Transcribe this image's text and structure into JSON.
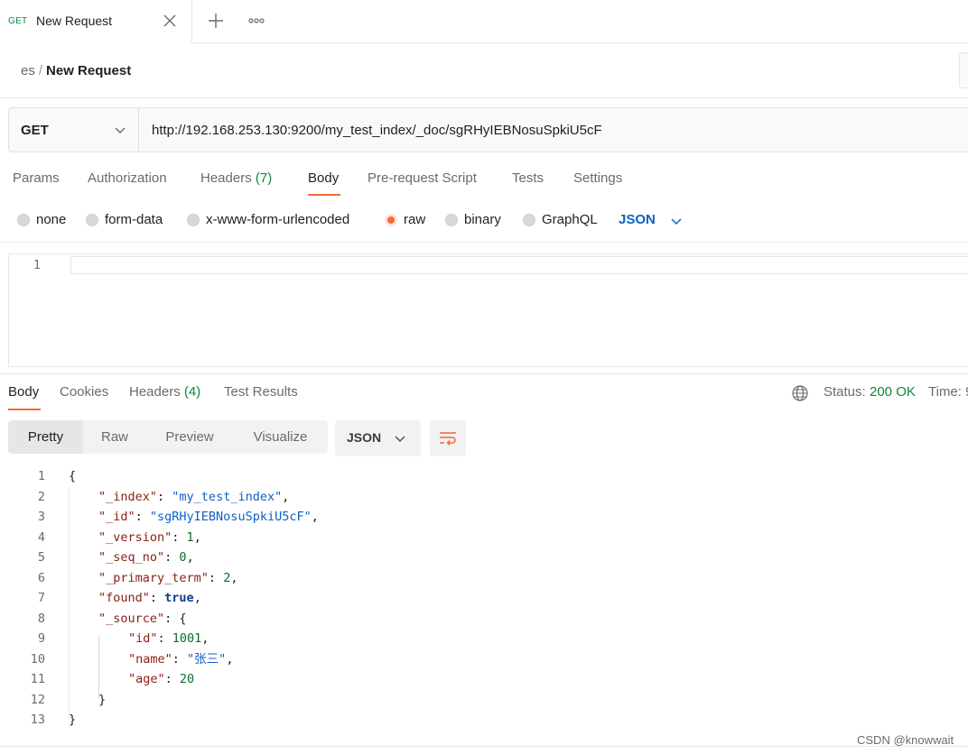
{
  "tab": {
    "method": "GET",
    "title": "New Request"
  },
  "breadcrumb": {
    "parent": "es",
    "separator": "/",
    "current": "New Request"
  },
  "request": {
    "method": "GET",
    "url": "http://192.168.253.130:9200/my_test_index/_doc/sgRHyIEBNosuSpkiU5cF"
  },
  "request_tabs": {
    "params": "Params",
    "authorization": "Authorization",
    "headers": "Headers",
    "headers_count": "(7)",
    "body": "Body",
    "pre_request": "Pre-request Script",
    "tests": "Tests",
    "settings": "Settings"
  },
  "body_types": {
    "none": "none",
    "form_data": "form-data",
    "urlencoded": "x-www-form-urlencoded",
    "raw": "raw",
    "binary": "binary",
    "graphql": "GraphQL",
    "format": "JSON",
    "selected": "raw"
  },
  "request_editor": {
    "line_number": "1"
  },
  "response_tabs": {
    "body": "Body",
    "cookies": "Cookies",
    "headers": "Headers",
    "headers_count": "(4)",
    "test_results": "Test Results"
  },
  "status": {
    "label": "Status:",
    "value": "200 OK",
    "time_label": "Time: 9"
  },
  "view_modes": {
    "pretty": "Pretty",
    "raw": "Raw",
    "preview": "Preview",
    "visualize": "Visualize",
    "format": "JSON"
  },
  "response_lines": [
    {
      "n": "1",
      "indent": 0,
      "parts": [
        [
          "p",
          "{"
        ]
      ]
    },
    {
      "n": "2",
      "indent": 1,
      "parts": [
        [
          "k",
          "\"_index\""
        ],
        [
          "p",
          ": "
        ],
        [
          "sv",
          "\"my_test_index\""
        ],
        [
          "p",
          ","
        ]
      ]
    },
    {
      "n": "3",
      "indent": 1,
      "parts": [
        [
          "k",
          "\"_id\""
        ],
        [
          "p",
          ": "
        ],
        [
          "sv",
          "\"sgRHyIEBNosuSpkiU5cF\""
        ],
        [
          "p",
          ","
        ]
      ]
    },
    {
      "n": "4",
      "indent": 1,
      "parts": [
        [
          "k",
          "\"_version\""
        ],
        [
          "p",
          ": "
        ],
        [
          "nv",
          "1"
        ],
        [
          "p",
          ","
        ]
      ]
    },
    {
      "n": "5",
      "indent": 1,
      "parts": [
        [
          "k",
          "\"_seq_no\""
        ],
        [
          "p",
          ": "
        ],
        [
          "nv",
          "0"
        ],
        [
          "p",
          ","
        ]
      ]
    },
    {
      "n": "6",
      "indent": 1,
      "parts": [
        [
          "k",
          "\"_primary_term\""
        ],
        [
          "p",
          ": "
        ],
        [
          "nv",
          "2"
        ],
        [
          "p",
          ","
        ]
      ]
    },
    {
      "n": "7",
      "indent": 1,
      "parts": [
        [
          "k",
          "\"found\""
        ],
        [
          "p",
          ": "
        ],
        [
          "bv",
          "true"
        ],
        [
          "p",
          ","
        ]
      ]
    },
    {
      "n": "8",
      "indent": 1,
      "parts": [
        [
          "k",
          "\"_source\""
        ],
        [
          "p",
          ": {"
        ]
      ]
    },
    {
      "n": "9",
      "indent": 2,
      "parts": [
        [
          "k",
          "\"id\""
        ],
        [
          "p",
          ": "
        ],
        [
          "nv",
          "1001"
        ],
        [
          "p",
          ","
        ]
      ]
    },
    {
      "n": "10",
      "indent": 2,
      "parts": [
        [
          "k",
          "\"name\""
        ],
        [
          "p",
          ": "
        ],
        [
          "sv",
          "\"张三\""
        ],
        [
          "p",
          ","
        ]
      ]
    },
    {
      "n": "11",
      "indent": 2,
      "parts": [
        [
          "k",
          "\"age\""
        ],
        [
          "p",
          ": "
        ],
        [
          "nv",
          "20"
        ]
      ]
    },
    {
      "n": "12",
      "indent": 1,
      "parts": [
        [
          "p",
          "}"
        ]
      ]
    },
    {
      "n": "13",
      "indent": 0,
      "parts": [
        [
          "p",
          "}"
        ]
      ]
    }
  ],
  "watermark": "CSDN @knowwait",
  "colors": {
    "accent": "#f26b3a",
    "success": "#0b8a3e",
    "link": "#0d61c4"
  }
}
